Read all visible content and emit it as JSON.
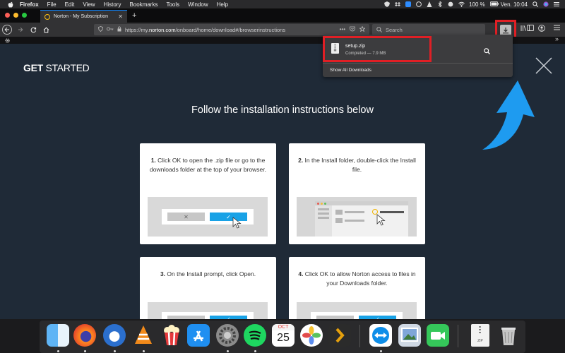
{
  "menubar": {
    "app_name": "Firefox",
    "items": [
      "File",
      "Edit",
      "View",
      "History",
      "Bookmarks",
      "Tools",
      "Window",
      "Help"
    ],
    "battery": "100 %",
    "clock": "Ven. 10:04"
  },
  "tab": {
    "title": "Norton - My Subscription",
    "close_glyph": "✕",
    "new_tab_glyph": "+"
  },
  "navbar": {
    "url_prefix": "https://my.",
    "url_host": "norton.com",
    "url_path": "/onboard/home/download#/browserinstructions",
    "search_placeholder": "Search"
  },
  "downloads_panel": {
    "file_name": "setup.zip",
    "status": "Completed — 7.9 MB",
    "show_all": "Show All Downloads"
  },
  "page": {
    "get_started_bold": "GET",
    "get_started_rest": " STARTED",
    "heading": "Follow the installation instructions below",
    "steps": [
      {
        "num": "1.",
        "text": " Click OK to open the .zip file or go to the downloads folder at the top of your browser."
      },
      {
        "num": "2.",
        "text": " In the Install folder, double-click the Install file."
      },
      {
        "num": "3.",
        "text": " On the Install prompt, click Open."
      },
      {
        "num": "4.",
        "text": " Click OK to allow Norton access to files in your Downloads folder."
      }
    ]
  },
  "dock": {
    "apps": [
      "finder",
      "firefox",
      "thunderbird",
      "vlc",
      "popcorn-time",
      "app-store",
      "system-preferences",
      "spotify",
      "calendar",
      "photos",
      "plex",
      "teamviewer",
      "preview",
      "facetime",
      "zip-file",
      "trash"
    ],
    "calendar_month": "OCT",
    "calendar_day": "25",
    "zip_label": "ZIP"
  },
  "colors": {
    "highlight_red": "#e01f25",
    "page_bg": "#1f2a37",
    "arrow_blue": "#1e9bf0",
    "accent_blue": "#19a2e6"
  }
}
